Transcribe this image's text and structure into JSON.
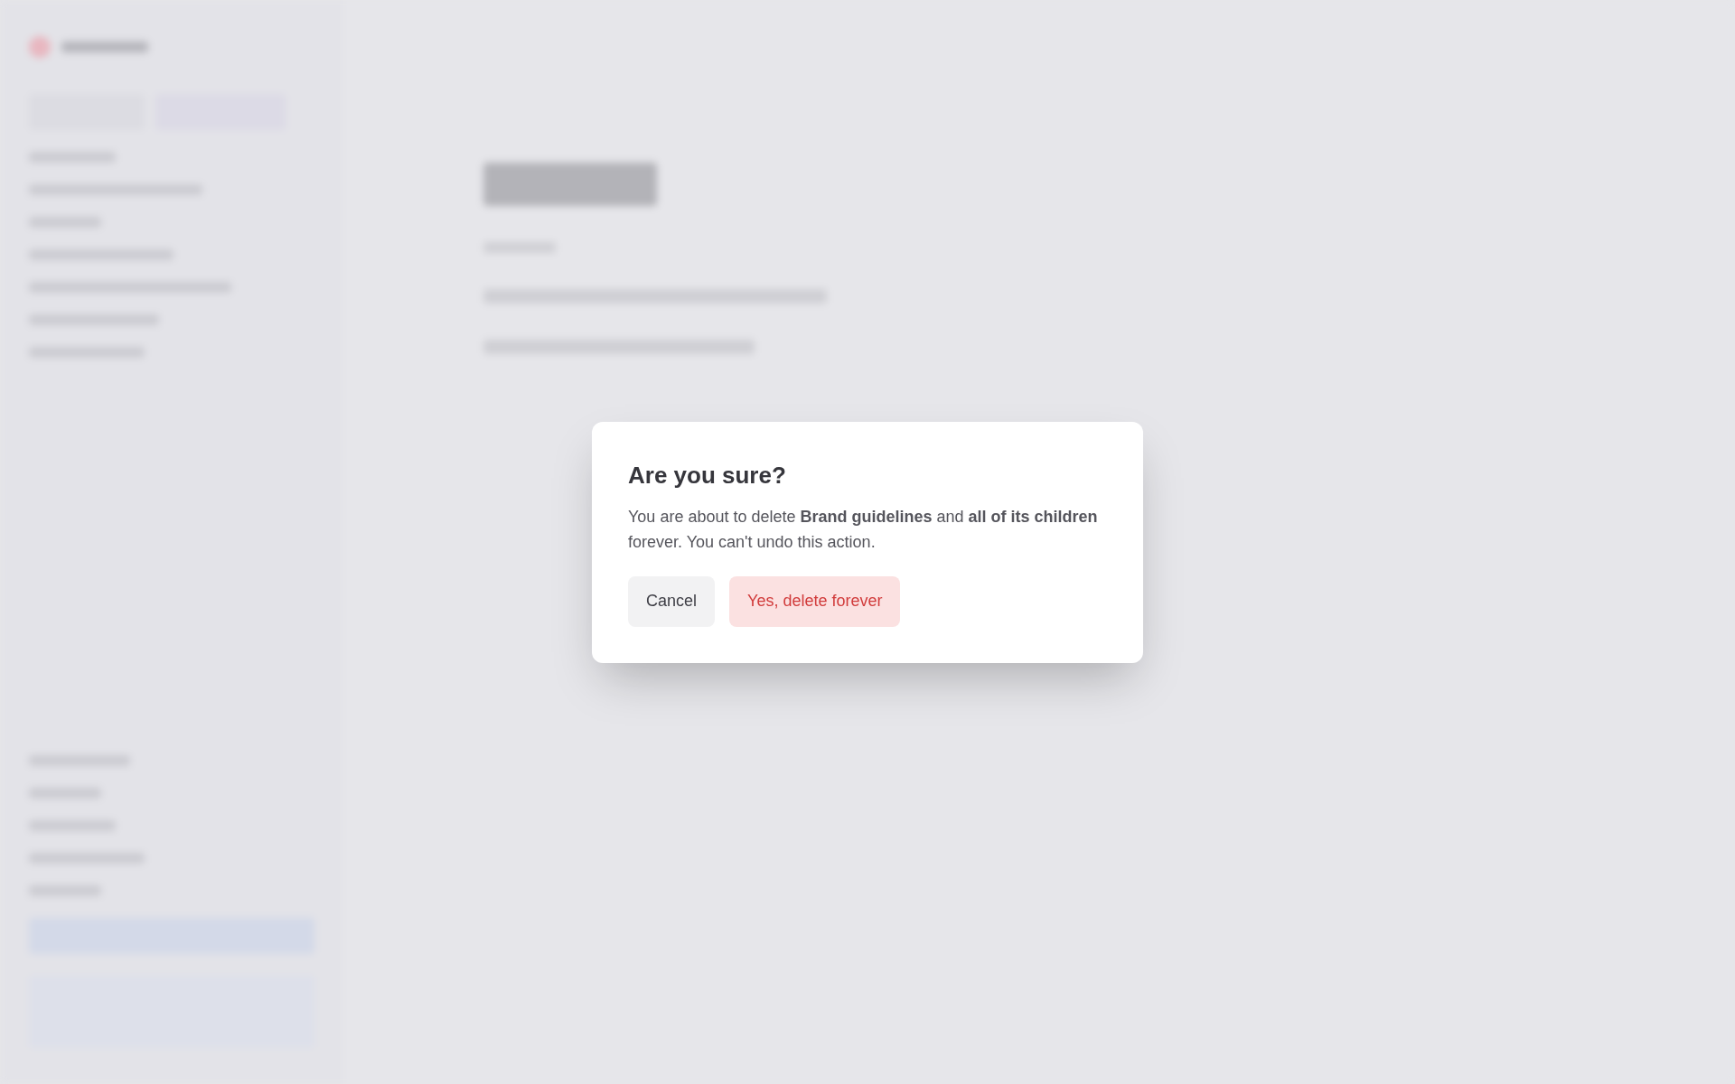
{
  "dialog": {
    "title": "Are you sure?",
    "message": "You are about to delete **Brand guidelines** and **all of its children** forever. You can't undo this action.",
    "buttons": [
      {
        "label": "Cancel",
        "kind": "secondary"
      },
      {
        "label": "Yes, delete forever",
        "kind": "danger"
      }
    ]
  }
}
